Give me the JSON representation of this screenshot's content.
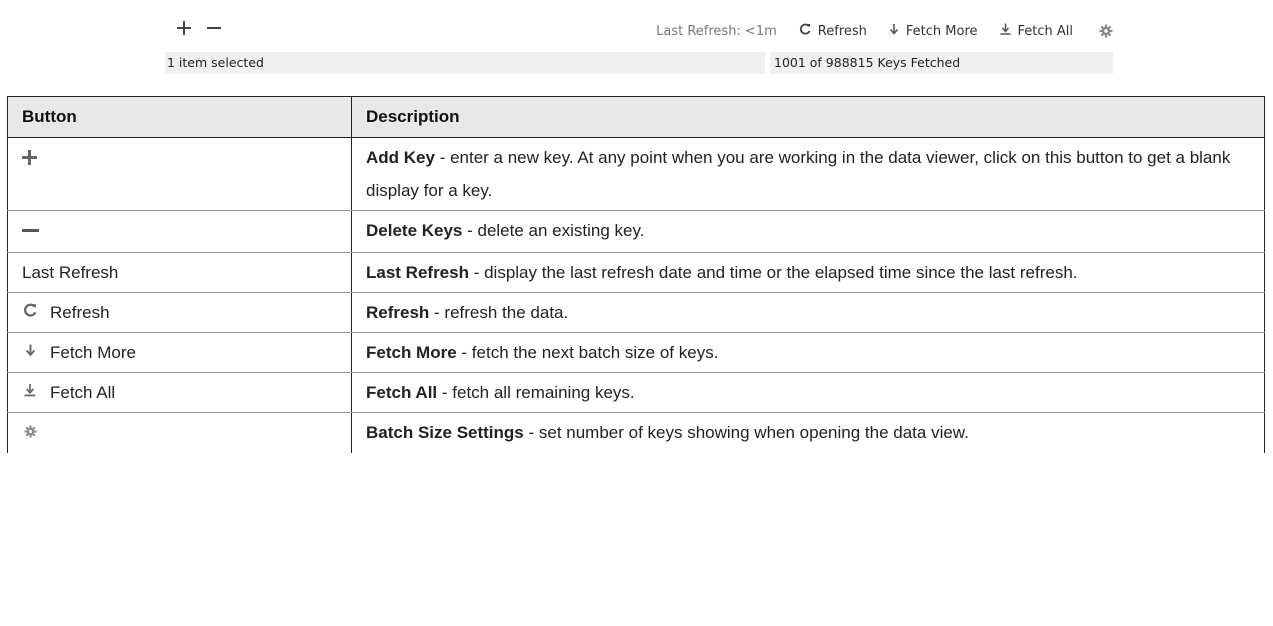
{
  "toolbar": {
    "last_refresh_label": "Last Refresh: <1m",
    "refresh_label": "Refresh",
    "fetch_more_label": "Fetch More",
    "fetch_all_label": "Fetch All",
    "icons": {
      "add": "plus-icon",
      "remove": "minus-icon",
      "refresh": "refresh-icon",
      "fetch_more": "arrow-down-icon",
      "fetch_all": "arrow-down-bar-icon",
      "settings": "gear-icon"
    }
  },
  "statusbar": {
    "selection": "1 item selected",
    "fetched": "1001 of 988815 Keys Fetched"
  },
  "table": {
    "headers": [
      "Button",
      "Description"
    ],
    "rows": [
      {
        "button": "",
        "icon": "plus-icon",
        "term": "Add Key",
        "desc": " - enter a new key. At any point when you are working in the data viewer, click on this button to get a blank display for a key."
      },
      {
        "button": "",
        "icon": "minus-icon",
        "term": "Delete Keys",
        "desc": " - delete an existing key."
      },
      {
        "button": "Last Refresh",
        "icon": "",
        "term": "Last Refresh",
        "desc": " - display the last refresh date and time or the elapsed time since the last refresh."
      },
      {
        "button": "Refresh",
        "icon": "refresh-icon",
        "term": "Refresh",
        "desc": " - refresh the data."
      },
      {
        "button": "Fetch More",
        "icon": "arrow-down-icon",
        "term": "Fetch More",
        "desc": " - fetch the next batch size of keys."
      },
      {
        "button": "Fetch All",
        "icon": "arrow-down-bar-icon",
        "term": "Fetch All",
        "desc": " - fetch all remaining keys."
      },
      {
        "button": "",
        "icon": "gear-icon",
        "term": "Batch Size Settings",
        "desc": " - set number of keys showing when opening the data view."
      }
    ]
  }
}
